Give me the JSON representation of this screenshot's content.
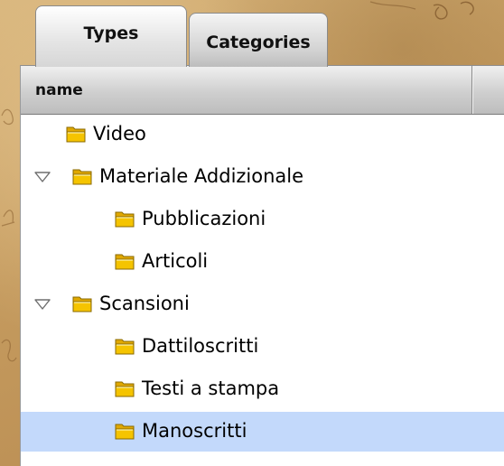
{
  "tabs": {
    "types_label": "Types",
    "categories_label": "Categories",
    "active": "Types"
  },
  "table": {
    "column_name": "name"
  },
  "tree": {
    "items": [
      {
        "label": "Video",
        "level": 1,
        "expandable": false,
        "expanded": false,
        "selected": false
      },
      {
        "label": "Materiale Addizionale",
        "level": 0,
        "expandable": true,
        "expanded": true,
        "selected": false
      },
      {
        "label": "Pubblicazioni",
        "level": 2,
        "expandable": false,
        "expanded": false,
        "selected": false
      },
      {
        "label": "Articoli",
        "level": 2,
        "expandable": false,
        "expanded": false,
        "selected": false
      },
      {
        "label": "Scansioni",
        "level": 0,
        "expandable": true,
        "expanded": true,
        "selected": false
      },
      {
        "label": "Dattiloscritti",
        "level": 2,
        "expandable": false,
        "expanded": false,
        "selected": false
      },
      {
        "label": "Testi a stampa",
        "level": 2,
        "expandable": false,
        "expanded": false,
        "selected": false
      },
      {
        "label": "Manoscritti",
        "level": 2,
        "expandable": false,
        "expanded": false,
        "selected": true
      }
    ]
  },
  "icons": {
    "folder": "folder-icon",
    "disclosure_open": "disclosure-triangle-open-icon"
  },
  "colors": {
    "selection": "#c3d9fb",
    "folder_fill": "#f5c400",
    "folder_stroke": "#8a6a00"
  }
}
